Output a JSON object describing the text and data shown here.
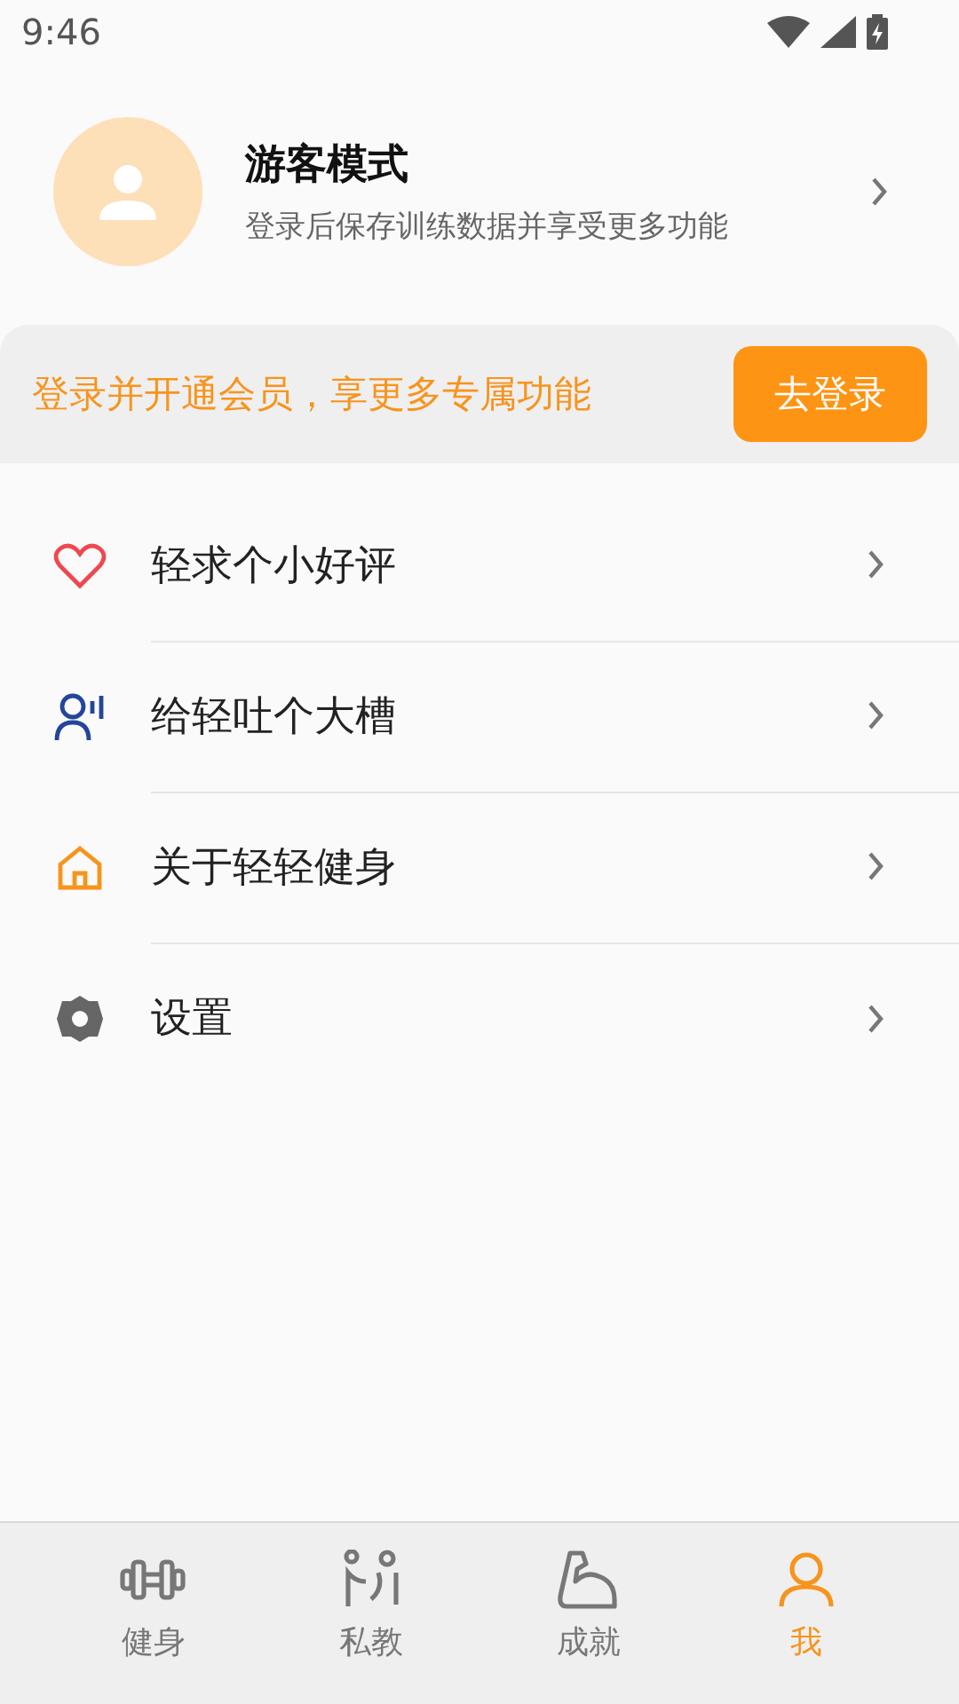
{
  "status_bar": {
    "time": "9:46"
  },
  "profile": {
    "title": "游客模式",
    "subtitle": "登录后保存训练数据并享受更多功能"
  },
  "banner": {
    "text": "登录并开通会员，享更多专属功能",
    "button": "去登录"
  },
  "menu": [
    {
      "label": "轻求个小好评"
    },
    {
      "label": "给轻吐个大槽"
    },
    {
      "label": "关于轻轻健身"
    },
    {
      "label": "设置"
    }
  ],
  "tabs": [
    {
      "label": "健身",
      "selected": false
    },
    {
      "label": "私教",
      "selected": false
    },
    {
      "label": "成就",
      "selected": false
    },
    {
      "label": "我",
      "selected": true
    }
  ]
}
